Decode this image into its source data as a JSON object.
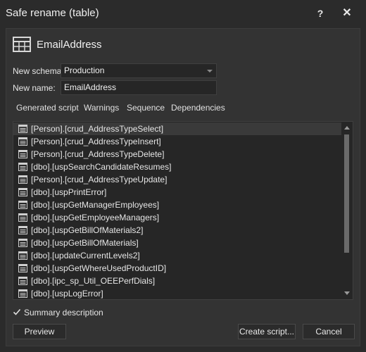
{
  "window": {
    "title": "Safe rename (table)",
    "help_label": "?",
    "close_label": "✕"
  },
  "header": {
    "object_name": "EmailAddress",
    "icon": "table-icon"
  },
  "form": {
    "schema_label": "New schema:",
    "schema_value": "Production",
    "name_label": "New name:",
    "name_value": "EmailAddress"
  },
  "tabs": [
    {
      "label": "Generated script"
    },
    {
      "label": "Warnings"
    },
    {
      "label": "Sequence"
    },
    {
      "label": "Dependencies"
    }
  ],
  "dependencies": [
    {
      "text": "[Person].[crud_AddressTypeSelect]",
      "icon": "procedure-icon"
    },
    {
      "text": "[Person].[crud_AddressTypeInsert]",
      "icon": "procedure-icon"
    },
    {
      "text": "[Person].[crud_AddressTypeDelete]",
      "icon": "procedure-icon"
    },
    {
      "text": "[dbo].[uspSearchCandidateResumes]",
      "icon": "procedure-icon"
    },
    {
      "text": "[Person].[crud_AddressTypeUpdate]",
      "icon": "procedure-icon"
    },
    {
      "text": "[dbo].[uspPrintError]",
      "icon": "procedure-icon"
    },
    {
      "text": "[dbo].[uspGetManagerEmployees]",
      "icon": "procedure-icon"
    },
    {
      "text": "[dbo].[uspGetEmployeeManagers]",
      "icon": "procedure-icon"
    },
    {
      "text": "[dbo].[uspGetBillOfMaterials2]",
      "icon": "procedure-icon"
    },
    {
      "text": "[dbo].[uspGetBillOfMaterials]",
      "icon": "procedure-icon"
    },
    {
      "text": "[dbo].[updateCurrentLevels2]",
      "icon": "procedure-icon"
    },
    {
      "text": "[dbo].[uspGetWhereUsedProductID]",
      "icon": "procedure-icon"
    },
    {
      "text": "[dbo].[ipc_sp_Util_OEEPerfDials]",
      "icon": "procedure-icon"
    },
    {
      "text": "[dbo].[uspLogError]",
      "icon": "procedure-icon"
    }
  ],
  "summary": {
    "label": "Summary description",
    "checked": true
  },
  "buttons": {
    "preview": "Preview",
    "create": "Create script...",
    "cancel": "Cancel"
  }
}
